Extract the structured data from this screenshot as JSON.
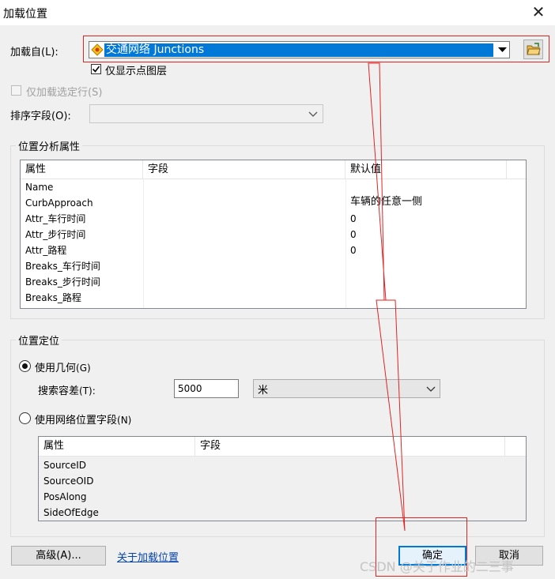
{
  "window": {
    "title": "加载位置",
    "close_glyph": "✕"
  },
  "load_from": {
    "label": "加载自",
    "accel": "(L):",
    "selected": "交通网络 Junctions",
    "layer_icon": "diamond-layer-icon",
    "browse_icon": "open-folder-icon"
  },
  "only_show_points": {
    "label": "仅显示点图层",
    "checked": true
  },
  "only_selected": {
    "label": "仅加载选定行",
    "accel": "(S)",
    "checked": false,
    "enabled": false
  },
  "sort_field": {
    "label": "排序字段",
    "accel": "(O):",
    "value": ""
  },
  "properties_group": {
    "title": "位置分析属性",
    "columns": [
      "属性",
      "字段",
      "默认值"
    ],
    "rows": [
      {
        "attr": "Name",
        "field": "",
        "default": ""
      },
      {
        "attr": "CurbApproach",
        "field": "",
        "default": "车辆的任意一侧"
      },
      {
        "attr": "Attr_车行时间",
        "field": "",
        "default": "0"
      },
      {
        "attr": "Attr_步行时间",
        "field": "",
        "default": "0"
      },
      {
        "attr": "Attr_路程",
        "field": "",
        "default": "0"
      },
      {
        "attr": "Breaks_车行时间",
        "field": "",
        "default": ""
      },
      {
        "attr": "Breaks_步行时间",
        "field": "",
        "default": ""
      },
      {
        "attr": "Breaks_路程",
        "field": "",
        "default": ""
      }
    ]
  },
  "location_group": {
    "title": "位置定位",
    "use_geometry": {
      "label": "使用几何",
      "accel": "(G)",
      "selected": true
    },
    "tolerance": {
      "label": "搜索容差",
      "accel": "(T):",
      "value": "5000",
      "unit": "米"
    },
    "use_network_fields": {
      "label": "使用网络位置字段",
      "accel": "(N)",
      "selected": false
    },
    "columns": [
      "属性",
      "字段"
    ],
    "rows": [
      "SourceID",
      "SourceOID",
      "PosAlong",
      "SideOfEdge"
    ]
  },
  "buttons": {
    "advanced": "高级(A)...",
    "about_link": "关于加载位置",
    "ok": "确定",
    "cancel": "取消"
  },
  "watermark": "CSDN @关于作业的二三事",
  "colors": {
    "selection": "#0078d7",
    "annotation": "#e02424",
    "link": "#0645ad"
  }
}
